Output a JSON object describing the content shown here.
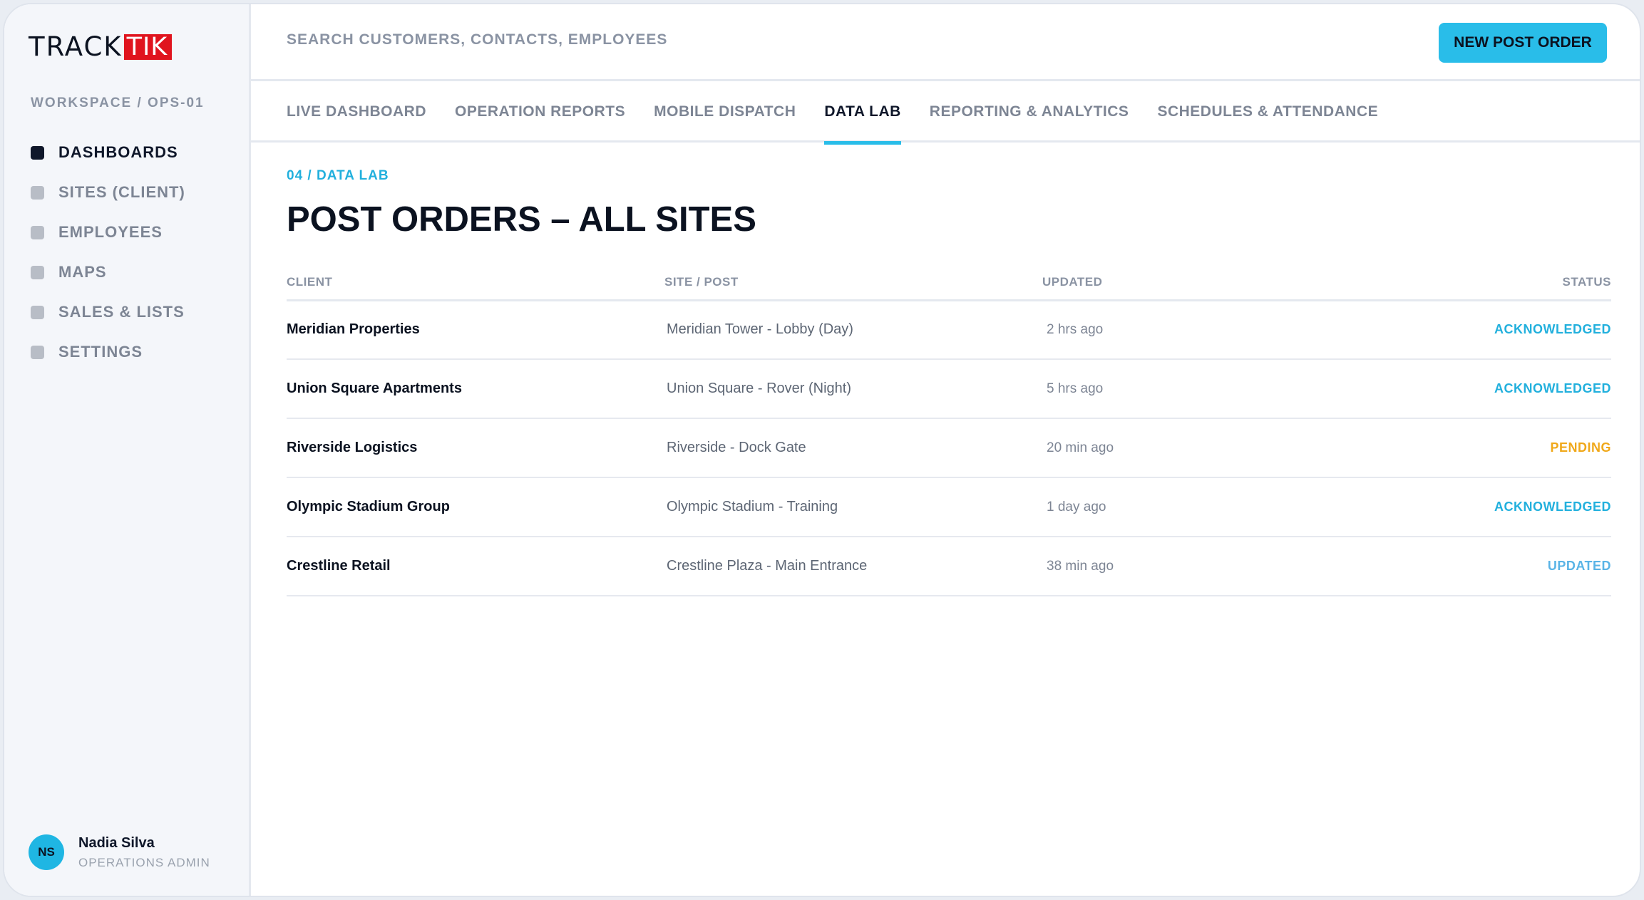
{
  "brand": {
    "logo_part1": "TRACK",
    "logo_part2": "TIK",
    "logo_red": "#e0141e"
  },
  "workspace": "WORKSPACE / OPS-01",
  "sidebar": {
    "items": [
      {
        "label": "DASHBOARDS",
        "active": true
      },
      {
        "label": "SITES (CLIENT)",
        "active": false
      },
      {
        "label": "EMPLOYEES",
        "active": false
      },
      {
        "label": "MAPS",
        "active": false
      },
      {
        "label": "SALES & LISTS",
        "active": false
      },
      {
        "label": "SETTINGS",
        "active": false
      }
    ]
  },
  "user": {
    "initials": "NS",
    "name": "Nadia Silva",
    "role": "OPERATIONS ADMIN"
  },
  "search": {
    "placeholder": "SEARCH CUSTOMERS, CONTACTS, EMPLOYEES"
  },
  "header": {
    "new_button": "NEW POST ORDER"
  },
  "tabs": [
    {
      "label": "LIVE DASHBOARD",
      "active": false
    },
    {
      "label": "OPERATION REPORTS",
      "active": false
    },
    {
      "label": "MOBILE DISPATCH",
      "active": false
    },
    {
      "label": "DATA LAB",
      "active": true
    },
    {
      "label": "REPORTING & ANALYTICS",
      "active": false
    },
    {
      "label": "SCHEDULES & ATTENDANCE",
      "active": false
    }
  ],
  "main": {
    "breadcrumb": "04 / DATA LAB",
    "title": "POST ORDERS – ALL SITES",
    "columns": {
      "client": "CLIENT",
      "site": "SITE / POST",
      "updated": "UPDATED",
      "status": "STATUS"
    },
    "rows": [
      {
        "client": "Meridian Properties",
        "site": "Meridian Tower - Lobby (Day)",
        "updated": "2 hrs ago",
        "status": "ACKNOWLEDGED"
      },
      {
        "client": "Union Square Apartments",
        "site": "Union Square - Rover (Night)",
        "updated": "5 hrs ago",
        "status": "ACKNOWLEDGED"
      },
      {
        "client": "Riverside Logistics",
        "site": "Riverside - Dock Gate",
        "updated": "20 min ago",
        "status": "PENDING"
      },
      {
        "client": "Olympic Stadium Group",
        "site": "Olympic Stadium - Training",
        "updated": "1 day ago",
        "status": "ACKNOWLEDGED"
      },
      {
        "client": "Crestline Retail",
        "site": "Crestline Plaza - Main Entrance",
        "updated": "38 min ago",
        "status": "UPDATED"
      }
    ]
  },
  "colors": {
    "accent": "#29bde9",
    "acknowledged": "#22b0dd",
    "pending": "#f0a81a",
    "updated": "#5ab4e6"
  }
}
